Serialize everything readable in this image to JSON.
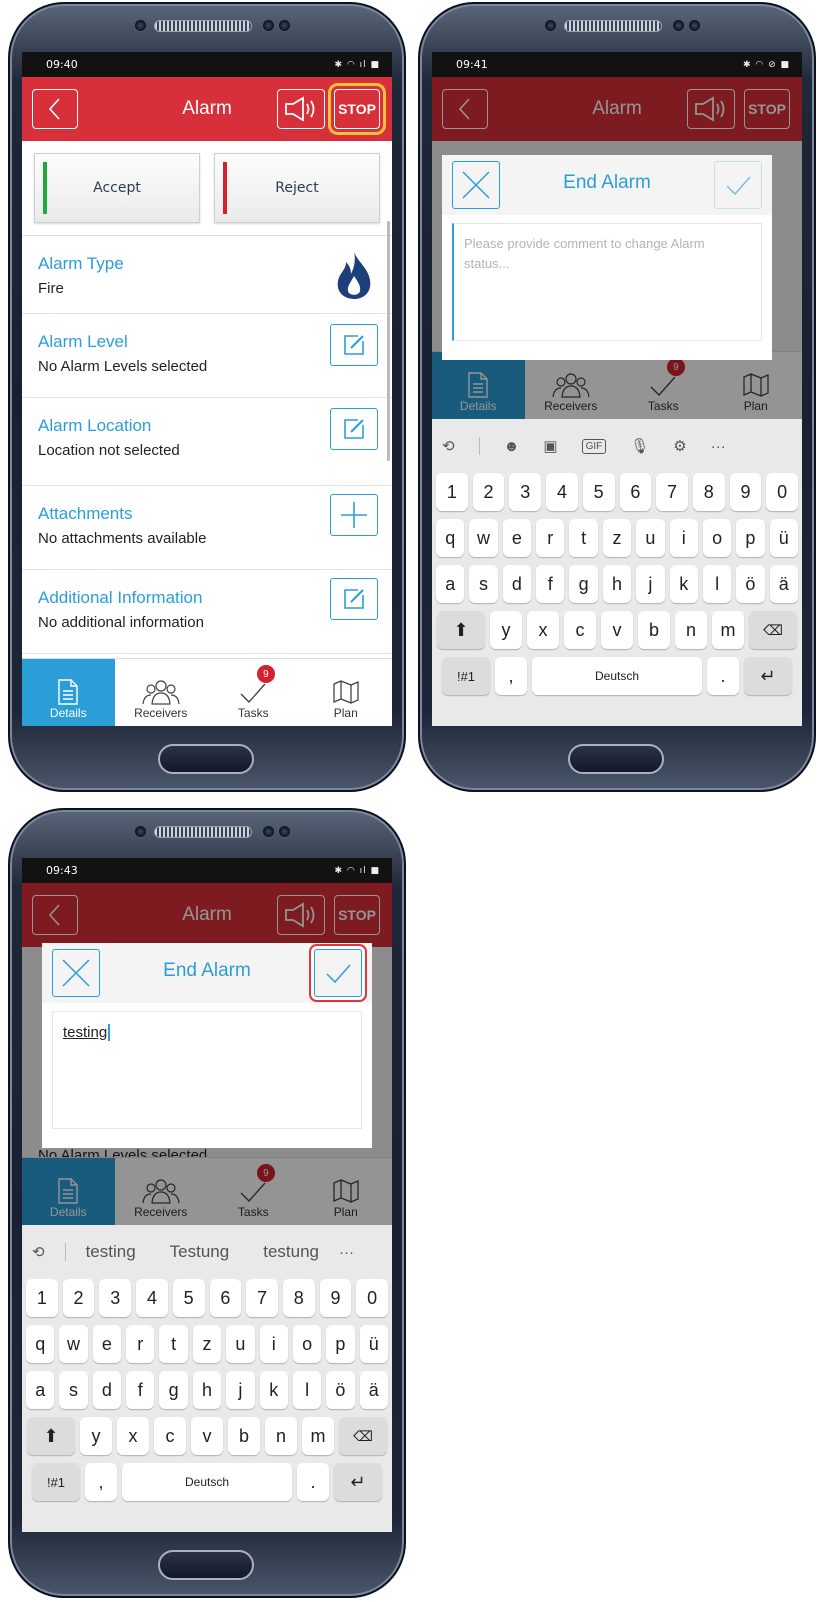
{
  "colors": {
    "header": "#d8303a",
    "accent": "#2b9ed8",
    "accept_bar": "#1faa3a",
    "reject_bar": "#d3212e",
    "badge": "#d3212e",
    "stop_highlight": "#f0c23a",
    "confirm_highlight": "#e0363e"
  },
  "icons": {
    "back": "chevron-left-icon",
    "sound": "speaker-icon",
    "fire": "fire-icon",
    "edit": "edit-icon",
    "add": "plus-icon",
    "close": "close-icon",
    "confirm": "check-icon",
    "details": "document-icon",
    "receivers": "people-icon",
    "tasks": "check-icon",
    "plan": "map-icon"
  },
  "screens": [
    {
      "status": {
        "time": "09:40"
      },
      "header": {
        "title": "Alarm",
        "stop": "STOP"
      },
      "buttons": {
        "accept": "Accept",
        "reject": "Reject"
      },
      "rows": [
        {
          "label": "Alarm Type",
          "value": "Fire"
        },
        {
          "label": "Alarm Level",
          "value": "No Alarm Levels selected"
        },
        {
          "label": "Alarm Location",
          "value": "Location not selected"
        },
        {
          "label": "Attachments",
          "value": "No attachments available"
        },
        {
          "label": "Additional Information",
          "value": "No additional information"
        }
      ],
      "tabs": [
        {
          "label": "Details"
        },
        {
          "label": "Receivers"
        },
        {
          "label": "Tasks",
          "badge": "9"
        },
        {
          "label": "Plan"
        }
      ]
    },
    {
      "status": {
        "time": "09:41"
      },
      "header": {
        "title": "Alarm",
        "stop": "STOP"
      },
      "dialog": {
        "title": "End Alarm",
        "placeholder": "Please provide comment to change Alarm status..."
      },
      "tabs": [
        {
          "label": "Details"
        },
        {
          "label": "Receivers"
        },
        {
          "label": "Tasks",
          "badge": "9"
        },
        {
          "label": "Plan"
        }
      ],
      "keyboard": {
        "row1": [
          "1",
          "2",
          "3",
          "4",
          "5",
          "6",
          "7",
          "8",
          "9",
          "0"
        ],
        "row2": [
          "q",
          "w",
          "e",
          "r",
          "t",
          "z",
          "u",
          "i",
          "o",
          "p",
          "ü"
        ],
        "row3": [
          "a",
          "s",
          "d",
          "f",
          "g",
          "h",
          "j",
          "k",
          "l",
          "ö",
          "ä"
        ],
        "row4": [
          "y",
          "x",
          "c",
          "v",
          "b",
          "n",
          "m"
        ],
        "sym": "!#1",
        "comma": ",",
        "space": "Deutsch",
        "period": ".",
        "gif": "GIF",
        "more": "···"
      }
    },
    {
      "status": {
        "time": "09:43"
      },
      "header": {
        "title": "Alarm",
        "stop": "STOP"
      },
      "dialog": {
        "title": "End Alarm",
        "text": "testing"
      },
      "bg_partial": "No Alarm Levels selected",
      "tabs": [
        {
          "label": "Details"
        },
        {
          "label": "Receivers"
        },
        {
          "label": "Tasks",
          "badge": "9"
        },
        {
          "label": "Plan"
        }
      ],
      "keyboard": {
        "suggestions": [
          "testing",
          "Testung",
          "testung"
        ],
        "more": "···",
        "row1": [
          "1",
          "2",
          "3",
          "4",
          "5",
          "6",
          "7",
          "8",
          "9",
          "0"
        ],
        "row2": [
          "q",
          "w",
          "e",
          "r",
          "t",
          "z",
          "u",
          "i",
          "o",
          "p",
          "ü"
        ],
        "row3": [
          "a",
          "s",
          "d",
          "f",
          "g",
          "h",
          "j",
          "k",
          "l",
          "ö",
          "ä"
        ],
        "row4": [
          "y",
          "x",
          "c",
          "v",
          "b",
          "n",
          "m"
        ],
        "sym": "!#1",
        "comma": ",",
        "space": "Deutsch",
        "period": "."
      }
    }
  ]
}
